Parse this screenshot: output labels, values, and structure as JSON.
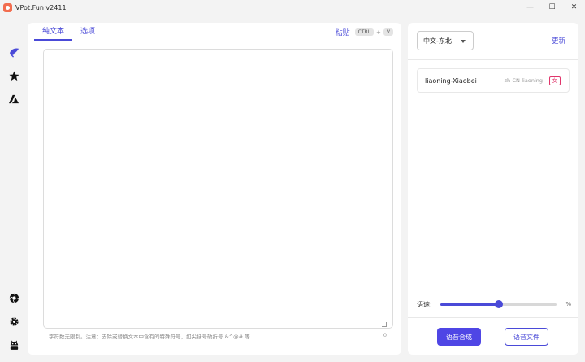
{
  "window": {
    "title": "VPot.Fun v2411",
    "minimize": "—",
    "maximize": "☐",
    "close": "✕"
  },
  "sidebar": {
    "top_icons": [
      "feather-icon",
      "star-icon",
      "azure-icon"
    ],
    "bottom_icons": [
      "aperture-icon",
      "gear-icon",
      "android-icon"
    ]
  },
  "main": {
    "tabs": [
      {
        "label": "纯文本",
        "active": true
      },
      {
        "label": "选项",
        "active": false
      }
    ],
    "paste_label": "粘贴",
    "shortcut": {
      "key1": "CTRL",
      "plus": "+",
      "key2": "V"
    },
    "editor_value": "",
    "hint": "字符数无限制。注意：去除或替换文本中含有的特殊符号，如尖括号破折号 &^@# 等",
    "char_count": "0"
  },
  "right": {
    "language_select": "中文-东北",
    "refresh_label": "更新",
    "voices": [
      {
        "name": "liaoning-Xiaobei",
        "code": "zh-CN-liaoning",
        "gender": "女"
      }
    ],
    "speed": {
      "label": "语速:",
      "value": 0.5,
      "unit": "%"
    },
    "synthesize_button": "语音合成",
    "file_button": "语音文件"
  },
  "colors": {
    "accent": "#4f46e5",
    "gender_female": "#e0356b"
  }
}
